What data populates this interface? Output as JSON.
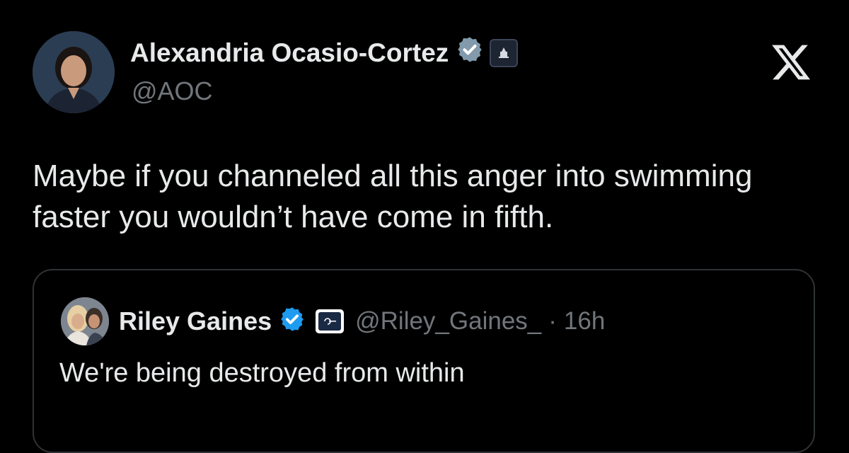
{
  "tweet": {
    "author_name": "Alexandria Ocasio-Cortez",
    "author_handle": "@AOC",
    "verified": true,
    "affiliation_icon": "capitol-icon",
    "text": "Maybe if you channeled all this anger into swimming faster you wouldn’t have come in fifth."
  },
  "brand_icon": "x-logo-icon",
  "quoted_tweet": {
    "author_name": "Riley Gaines",
    "author_handle": "@Riley_Gaines_",
    "separator": "·",
    "time": "16h",
    "verified": true,
    "affiliation_icon": "org-logo-icon",
    "text": "We're being destroyed from within"
  },
  "colors": {
    "background": "#000000",
    "primary_text": "#e7e9ea",
    "secondary_text": "#71767b",
    "verified_gray": "#829aab",
    "verified_blue": "#1d9bf0",
    "card_border": "#2f3336"
  }
}
